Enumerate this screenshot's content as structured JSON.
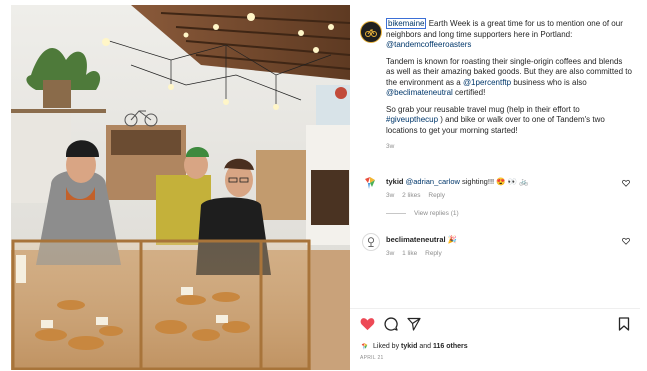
{
  "post": {
    "author_handle": "bikemaine",
    "caption_line1": " Earth Week is a great time for us to mention one of our neighbors and long time supporters here in Portland: ",
    "caption_mention1": "@tandemcoffeeroasters",
    "caption_para2_a": "Tandem is known for roasting their single-origin coffees and blends as well as their amazing baked goods. But they are also committed to the environment as a ",
    "caption_mention2": "@1percentftp",
    "caption_para2_b": " business who is also ",
    "caption_mention3": "@beclimateneutral",
    "caption_para2_c": " certified!",
    "caption_para3_a": "So grab your reusable travel mug (help in their effort to ",
    "caption_tag": "#giveupthecup",
    "caption_para3_b": " ) and bike or walk over to one of Tandem's two locations to get your morning started!",
    "time": "3w"
  },
  "comments": [
    {
      "user": "tykid",
      "mention": "@adrian_carlow",
      "text": " sighting!!! 😍 👀 🚲",
      "time": "3w",
      "likes": "2 likes",
      "reply": "Reply",
      "view_replies": "View replies (1)"
    },
    {
      "user": "beclimateneutral",
      "text": " 🎉",
      "time": "3w",
      "likes": "1 like",
      "reply": "Reply"
    }
  ],
  "likes_summary": {
    "prefix": "Liked by ",
    "user": "tykid",
    "middle": " and ",
    "others": "116 others"
  },
  "date": "APRIL 21",
  "icons": [
    "heart-filled-icon",
    "comment-icon",
    "share-icon",
    "bookmark-icon",
    "heart-outline-icon"
  ],
  "colors": {
    "like_red": "#ed4956",
    "link_blue": "#00376b",
    "muted": "#8e8e8e"
  }
}
